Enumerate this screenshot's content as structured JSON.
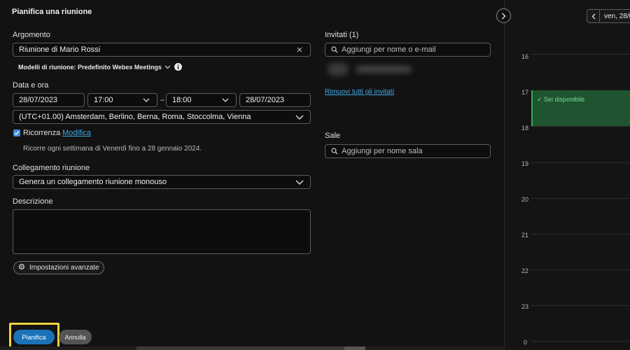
{
  "dialog": {
    "title": "Pianifica una riunione"
  },
  "form": {
    "topic_label": "Argomento",
    "topic_value": "Riunione di Mario Rossi",
    "templates_text": "Modelli di riunione: Predefinito Webex Meetings",
    "datetime_label": "Data e ora",
    "start_date": "28/07/2023",
    "start_time": "17:00",
    "dash": "–",
    "end_time": "18:00",
    "end_date": "28/07/2023",
    "timezone": "(UTC+01.00) Amsterdam, Berlino, Berna, Roma, Stoccolma, Vienna",
    "recurrence_label": "Ricorrenza",
    "recurrence_edit": "Modifica",
    "recurrence_summary": "Ricorre ogni settimana di Venerdì fino a 28 gennaio 2024.",
    "meeting_link_label": "Collegamento riunione",
    "meeting_link_value": "Genera un collegamento riunione monouso",
    "description_label": "Descrizione",
    "advanced_settings": "Impostazioni avanzate"
  },
  "invitees": {
    "label": "Invitati (1)",
    "search_placeholder": "Aggiungi per nome o e-mail",
    "remove_all": "Rimuovi tutti gli invitati"
  },
  "rooms": {
    "label": "Sale",
    "search_placeholder": "Aggiungi per nome sala"
  },
  "actions": {
    "schedule": "Pianifica",
    "cancel": "Annulla"
  },
  "calendar": {
    "date_header": "ven, 28/0",
    "hours": [
      "16",
      "17",
      "18",
      "19",
      "20",
      "21",
      "22",
      "23",
      "0"
    ],
    "availability": "Sei disponibile"
  },
  "colors": {
    "accent": "#1a73b8",
    "link": "#3fa9e6",
    "available_bg": "#1f5430",
    "highlight": "#f0d23c"
  }
}
